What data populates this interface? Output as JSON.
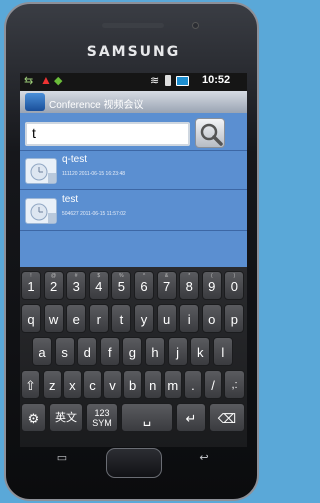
{
  "brand": "SAMSUNG",
  "statusbar": {
    "time": "10:52"
  },
  "app": {
    "title": "Conference 视频会议"
  },
  "search": {
    "value": "t"
  },
  "results": [
    {
      "title": "q-test",
      "subtitle": "111120  2011-06-15 16:23:48"
    },
    {
      "title": "test",
      "subtitle": "504627  2011-06-15 11:57:02"
    }
  ],
  "keyboard": {
    "row1": [
      {
        "label": "1",
        "hint": "!"
      },
      {
        "label": "2",
        "hint": "@"
      },
      {
        "label": "3",
        "hint": "#"
      },
      {
        "label": "4",
        "hint": "$"
      },
      {
        "label": "5",
        "hint": "%"
      },
      {
        "label": "6",
        "hint": "^"
      },
      {
        "label": "7",
        "hint": "&"
      },
      {
        "label": "8",
        "hint": "*"
      },
      {
        "label": "9",
        "hint": "("
      },
      {
        "label": "0",
        "hint": ")"
      }
    ],
    "row2": [
      "q",
      "w",
      "e",
      "r",
      "t",
      "y",
      "u",
      "i",
      "o",
      "p"
    ],
    "row3": [
      "a",
      "s",
      "d",
      "f",
      "g",
      "h",
      "j",
      "k",
      "l"
    ],
    "row4": [
      "z",
      "x",
      "c",
      "v",
      "b",
      "n",
      "m",
      ".",
      "/"
    ],
    "lang_key": "英文",
    "sym_key_top": "123",
    "sym_key_bottom": "SYM"
  },
  "colors": {
    "content_bg": "#5b8fd1",
    "appbar_bg": "#aab3c0",
    "keyboard_bg": "#2a2b2e",
    "key_bg": "#4a4b4f"
  }
}
